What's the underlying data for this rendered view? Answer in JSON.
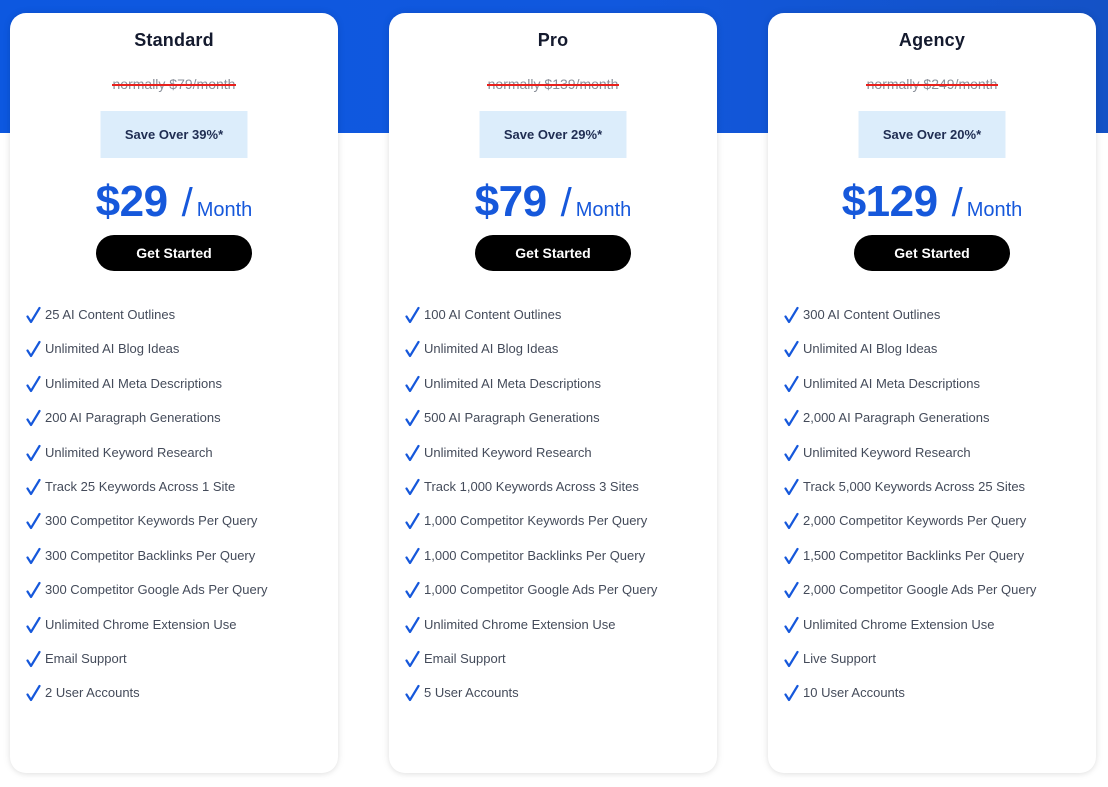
{
  "theme": {
    "brand_blue": "#1658db",
    "header_band": "#0d58e0",
    "badge_bg": "#dcedfb",
    "strike_red": "#e8201c",
    "cta_bg": "#000000"
  },
  "plans": [
    {
      "name": "Standard",
      "old_price": "normally $79/month",
      "save_badge": "Save Over 39%*",
      "price": "$29",
      "price_slash": "/",
      "period": "Month",
      "cta_label": "Get Started",
      "check_icon": "checkmark-icon",
      "features": [
        "25 AI Content Outlines",
        "Unlimited AI Blog Ideas",
        "Unlimited AI Meta Descriptions",
        "200 AI Paragraph Generations",
        "Unlimited Keyword Research",
        "Track 25 Keywords Across 1 Site",
        "300 Competitor Keywords Per Query",
        "300 Competitor Backlinks Per Query",
        "300 Competitor Google Ads Per Query",
        "Unlimited Chrome Extension Use",
        "Email Support",
        "2 User Accounts"
      ]
    },
    {
      "name": "Pro",
      "old_price": "normally $139/month",
      "save_badge": "Save Over 29%*",
      "price": "$79",
      "price_slash": "/",
      "period": "Month",
      "cta_label": "Get Started",
      "check_icon": "checkmark-icon",
      "features": [
        "100 AI Content Outlines",
        "Unlimited AI Blog Ideas",
        "Unlimited AI Meta Descriptions",
        "500 AI Paragraph Generations",
        "Unlimited Keyword Research",
        "Track 1,000 Keywords Across 3 Sites",
        "1,000 Competitor Keywords Per Query",
        "1,000 Competitor Backlinks Per Query",
        "1,000 Competitor Google Ads Per Query",
        "Unlimited Chrome Extension Use",
        "Email Support",
        "5 User Accounts"
      ]
    },
    {
      "name": "Agency",
      "old_price": "normally $249/month",
      "save_badge": "Save Over 20%*",
      "price": "$129",
      "price_slash": "/",
      "period": "Month",
      "cta_label": "Get Started",
      "check_icon": "checkmark-icon",
      "features": [
        "300 AI Content Outlines",
        "Unlimited AI Blog Ideas",
        "Unlimited AI Meta Descriptions",
        "2,000 AI Paragraph Generations",
        "Unlimited Keyword Research",
        "Track 5,000 Keywords Across 25 Sites",
        "2,000 Competitor Keywords Per Query",
        "1,500 Competitor Backlinks Per Query",
        "2,000 Competitor Google Ads Per Query",
        "Unlimited Chrome Extension Use",
        "Live Support",
        "10 User Accounts"
      ]
    }
  ]
}
